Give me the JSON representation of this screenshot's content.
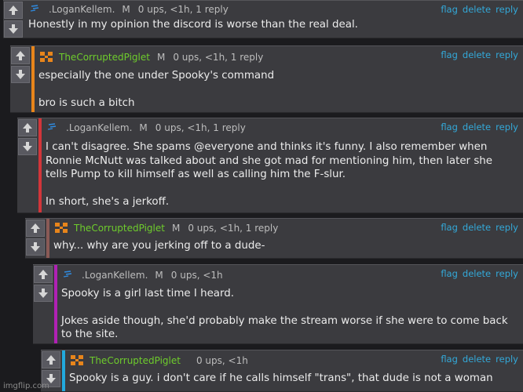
{
  "colors": {
    "background": "#1b1b1e",
    "card": "#3b3b3f",
    "link": "#33a9d9",
    "bar_orange": "#e8851b",
    "bar_red": "#d2353a",
    "bar_brown": "#8a5a56",
    "bar_magenta": "#b021b4",
    "bar_cyan": "#22a9dd",
    "username_green": "#6ecc2c"
  },
  "actions": {
    "flag": "flag",
    "delete": "delete",
    "reply": "reply"
  },
  "comments": [
    {
      "username": ".LoganKellem.",
      "avatar_icon": "blue-streak-icon",
      "badge": "M",
      "stats": "0 ups, <1h, 1 reply",
      "paragraphs": [
        "Honestly in my opinion the discord is worse than the real deal."
      ]
    },
    {
      "username": "TheCorruptedPiglet",
      "avatar_icon": "orange-cross-icon",
      "badge": "M",
      "stats": "0 ups, <1h, 1 reply",
      "paragraphs": [
        "especially the one under Spooky's command",
        "bro is such a bitch"
      ]
    },
    {
      "username": ".LoganKellem.",
      "avatar_icon": "blue-streak-icon",
      "badge": "M",
      "stats": "0 ups, <1h, 1 reply",
      "paragraphs": [
        "I can't disagree. She spams @everyone and thinks it's funny. I also remember when Ronnie McNutt was talked about and she got mad for mentioning him, then later she tells Pump to kill himself as well as calling him the F-slur.",
        "In short, she's a jerkoff."
      ]
    },
    {
      "username": "TheCorruptedPiglet",
      "avatar_icon": "orange-cross-icon",
      "badge": "M",
      "stats": "0 ups, <1h, 1 reply",
      "paragraphs": [
        "why... why are you jerking off to a dude-"
      ]
    },
    {
      "username": ".LoganKellem.",
      "avatar_icon": "blue-streak-icon",
      "badge": "M",
      "stats": "0 ups, <1h",
      "paragraphs": [
        "Spooky is a girl last time I heard.",
        "Jokes aside though, she'd probably make the stream worse if she were to come back to the site."
      ]
    },
    {
      "username": "TheCorruptedPiglet",
      "avatar_icon": "orange-cross-icon",
      "badge": "",
      "stats": "0 ups, <1h",
      "paragraphs": [
        "Spooky is a guy. i don't care if he calls himself \"trans\", that dude is not a woman"
      ]
    }
  ],
  "watermark": "imgflip.com"
}
